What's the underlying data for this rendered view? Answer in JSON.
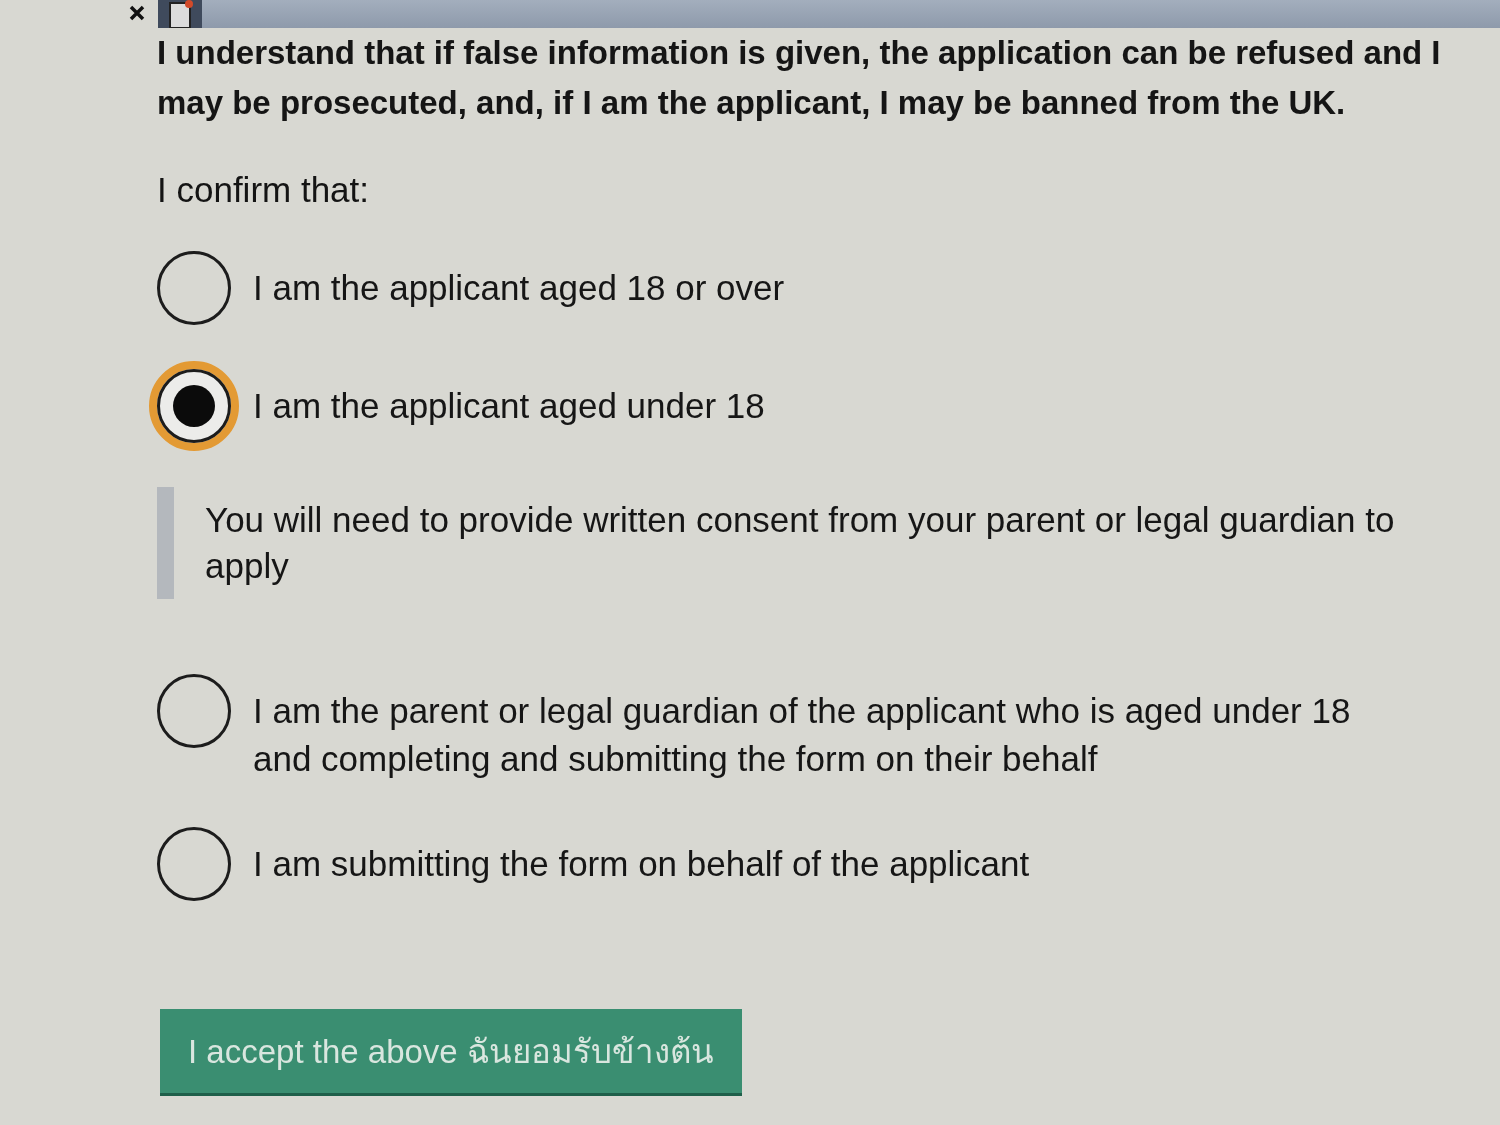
{
  "declaration": "I understand that if false information is given, the application can be refused and I may be prosecuted, and, if I am the applicant, I may be banned from the UK.",
  "confirm_label": "I confirm that:",
  "options": [
    {
      "label": "I am the applicant aged 18 or over",
      "selected": false,
      "focused": false
    },
    {
      "label": "I am the applicant aged under 18",
      "selected": true,
      "focused": true,
      "hint": "You will need to provide written consent from your parent or legal guardian to apply"
    },
    {
      "label": "I am the parent or legal guardian of the applicant who is aged under 18 and completing and submitting the form on their behalf",
      "selected": false,
      "focused": false
    },
    {
      "label": "I am submitting the form on behalf of the applicant",
      "selected": false,
      "focused": false
    }
  ],
  "submit_button": {
    "label": "I accept the above ฉันยอมรับข้างต้น"
  }
}
